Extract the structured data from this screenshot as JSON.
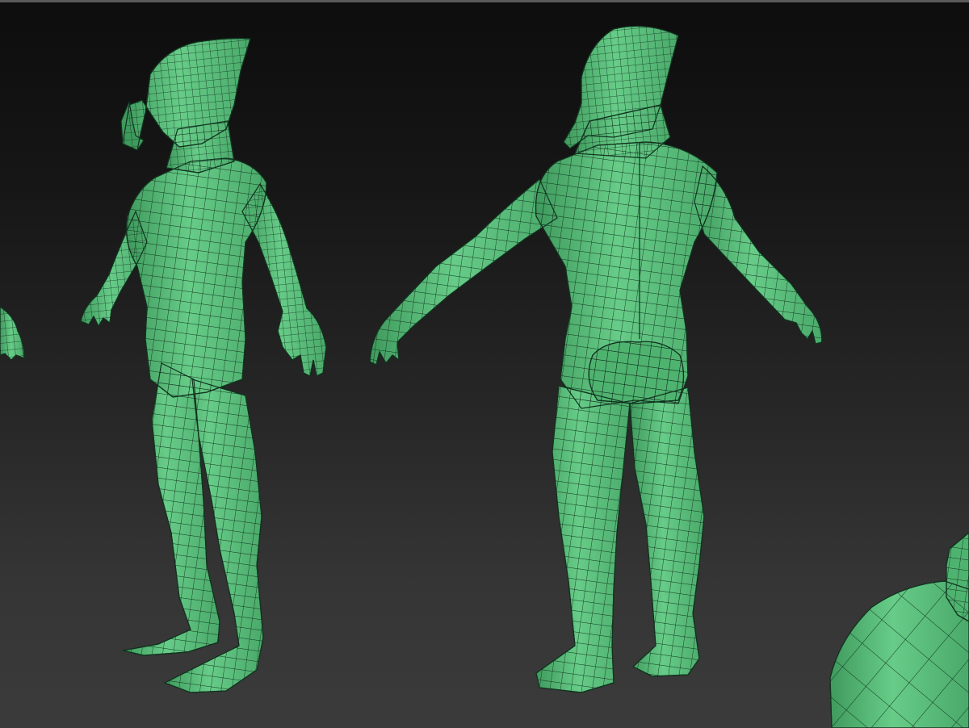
{
  "scene": {
    "description_hidden": "",
    "colors": {
      "mesh_fill": "#5cc27e",
      "mesh_light": "#72d493",
      "mesh_shadow": "#3f9a5d",
      "wire": "#11331f",
      "background_top": "#0d0d0d",
      "background_bottom": "#3b3b3b"
    }
  }
}
